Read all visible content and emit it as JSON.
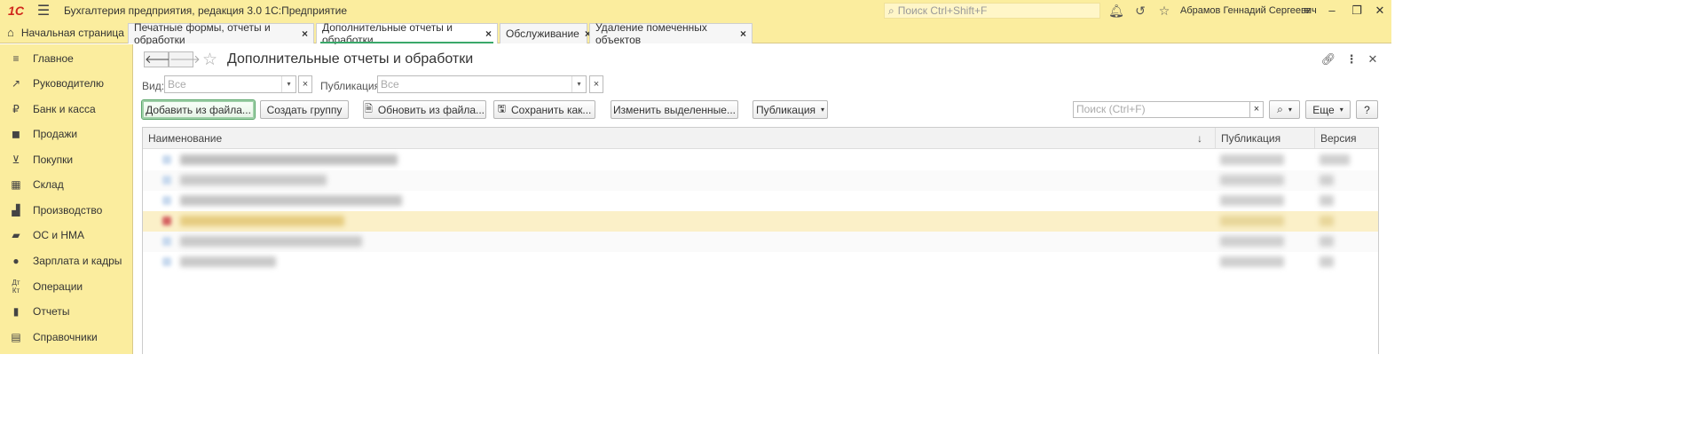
{
  "titlebar": {
    "logo": "1С",
    "app_title": "Бухгалтерия предприятия, редакция 3.0 1С:Предприятие",
    "search_placeholder": "Поиск Ctrl+Shift+F",
    "user_name": "Абрамов Геннадий Сергеевич"
  },
  "tabs": {
    "home": "Начальная страница",
    "items": [
      {
        "label": "Печатные формы, отчеты и обработки"
      },
      {
        "label": "Дополнительные отчеты и обработки"
      },
      {
        "label": "Обслуживание"
      },
      {
        "label": "Удаление помеченных объектов"
      }
    ]
  },
  "sidebar": {
    "items": [
      {
        "label": "Главное",
        "icon": "menu-icon"
      },
      {
        "label": "Руководителю",
        "icon": "trend-icon"
      },
      {
        "label": "Банк и касса",
        "icon": "ruble-icon"
      },
      {
        "label": "Продажи",
        "icon": "bag-icon"
      },
      {
        "label": "Покупки",
        "icon": "cart-icon"
      },
      {
        "label": "Склад",
        "icon": "grid-icon"
      },
      {
        "label": "Производство",
        "icon": "factory-icon"
      },
      {
        "label": "ОС и НМА",
        "icon": "truck-icon"
      },
      {
        "label": "Зарплата и кадры",
        "icon": "person-icon"
      },
      {
        "label": "Операции",
        "icon": "dt-kt-icon"
      },
      {
        "label": "Отчеты",
        "icon": "bar-chart-icon"
      },
      {
        "label": "Справочники",
        "icon": "book-icon"
      }
    ]
  },
  "page": {
    "title": "Дополнительные отчеты и обработки"
  },
  "filters": {
    "kind_label": "Вид:",
    "kind_value": "Все",
    "publication_label": "Публикация:",
    "publication_value": "Все"
  },
  "toolbar": {
    "add_from_file": "Добавить из файла...",
    "create_group": "Создать группу",
    "update_from_file": "Обновить из файла...",
    "save_as": "Сохранить как...",
    "change_selected": "Изменить выделенные...",
    "publication": "Публикация",
    "search_placeholder": "Поиск (Ctrl+F)",
    "more": "Еще",
    "help": "?"
  },
  "table": {
    "columns": {
      "name": "Наименование",
      "publication": "Публикация",
      "version": "Версия"
    },
    "rows": [
      {
        "selected": false
      },
      {
        "selected": false
      },
      {
        "selected": false
      },
      {
        "selected": true
      },
      {
        "selected": false
      },
      {
        "selected": false
      }
    ]
  },
  "colors": {
    "chrome_yellow": "#fbed9e",
    "selected_row": "#fbf0c8",
    "active_tab_underline": "#3aa86a",
    "logo_red": "#d0271c"
  }
}
